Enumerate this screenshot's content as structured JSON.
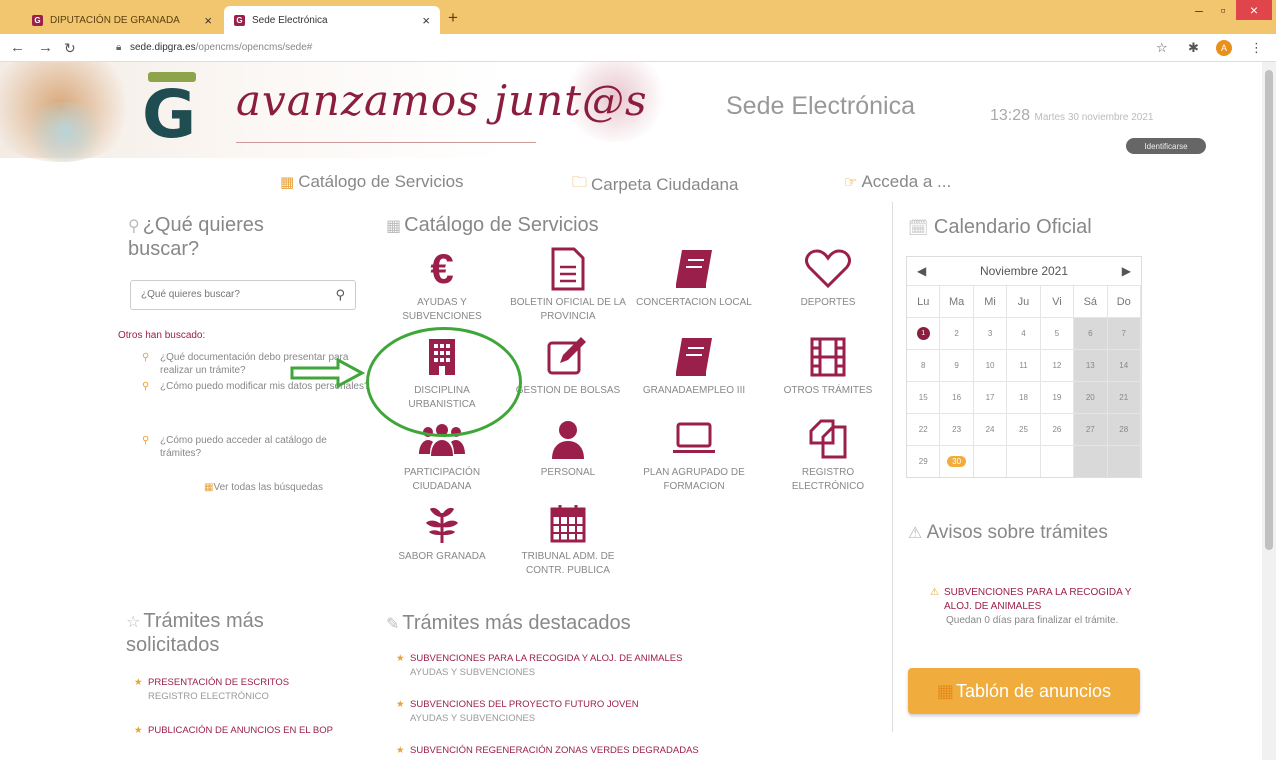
{
  "browser": {
    "tabs": [
      {
        "label": "DIPUTACIÓN DE GRANADA",
        "favicon": "G"
      },
      {
        "label": "Sede Electrónica",
        "favicon": "G"
      }
    ],
    "url_host": "sede.dipgra.es",
    "url_path": "/opencms/opencms/sede#",
    "profile_initial": "A"
  },
  "header": {
    "slogan": "avanzamos junt@s",
    "site_title": "Sede Electrónica",
    "time": "13:28",
    "date": "Martes 30 noviembre 2021",
    "login_label": "Identificarse"
  },
  "topnav": {
    "catalog": "Catálogo de Servicios",
    "folder": "Carpeta Ciudadana",
    "access": "Acceda a ..."
  },
  "search": {
    "title": "¿Qué quieres buscar?",
    "placeholder": "¿Qué quieres buscar?",
    "others_label": "Otros han buscado:",
    "items": [
      "¿Qué documentación debo presentar para realizar un trámite?",
      "¿Cómo puedo modificar mis datos personales?",
      "¿Cómo puedo acceder al catálogo de trámites?"
    ],
    "see_all": "Ver todas las búsquedas"
  },
  "catalog": {
    "title": "Catálogo de Servicios",
    "services": [
      {
        "label": "AYUDAS Y SUBVENCIONES",
        "icon": "euro-icon"
      },
      {
        "label": "BOLETIN OFICIAL DE LA PROVINCIA",
        "icon": "document-icon"
      },
      {
        "label": "CONCERTACION LOCAL",
        "icon": "book-icon"
      },
      {
        "label": "DEPORTES",
        "icon": "heart-icon"
      },
      {
        "label": "DISCIPLINA URBANISTICA",
        "icon": "building-icon"
      },
      {
        "label": "GESTION DE BOLSAS",
        "icon": "edit-icon"
      },
      {
        "label": "GRANADAEMPLEO III",
        "icon": "book-icon"
      },
      {
        "label": "OTROS TRÁMITES",
        "icon": "film-icon"
      },
      {
        "label": "PARTICIPACIÓN CIUDADANA",
        "icon": "group-icon"
      },
      {
        "label": "PERSONAL",
        "icon": "user-icon"
      },
      {
        "label": "PLAN AGRUPADO DE FORMACION",
        "icon": "laptop-icon"
      },
      {
        "label": "REGISTRO ELECTRÓNICO",
        "icon": "copy-icon"
      },
      {
        "label": "SABOR GRANADA",
        "icon": "leaf-icon"
      },
      {
        "label": "TRIBUNAL ADM. DE CONTR. PUBLICA",
        "icon": "calendar-icon"
      }
    ]
  },
  "calendar": {
    "title": "Calendario Oficial",
    "month": "Noviembre 2021",
    "weekdays": [
      "Lu",
      "Ma",
      "Mi",
      "Ju",
      "Vi",
      "Sá",
      "Do"
    ],
    "weeks": [
      [
        "1",
        "2",
        "3",
        "4",
        "5",
        "6",
        "7"
      ],
      [
        "8",
        "9",
        "10",
        "11",
        "12",
        "13",
        "14"
      ],
      [
        "15",
        "16",
        "17",
        "18",
        "19",
        "20",
        "21"
      ],
      [
        "22",
        "23",
        "24",
        "25",
        "26",
        "27",
        "28"
      ],
      [
        "29",
        "30",
        "",
        "",
        "",
        "",
        ""
      ]
    ]
  },
  "notices": {
    "title": "Avisos sobre trámites",
    "item_title": "SUBVENCIONES PARA LA RECOGIDA Y ALOJ. DE ANIMALES",
    "item_desc": "Quedan 0 días para finalizar el trámite."
  },
  "board_button": "Tablón de anuncios",
  "most_requested": {
    "title": "Trámites más solicitados",
    "items": [
      {
        "title": "PRESENTACIÓN DE ESCRITOS",
        "sub": "REGISTRO ELECTRÓNICO"
      },
      {
        "title": "PUBLICACIÓN DE ANUNCIOS EN EL BOP",
        "sub": ""
      }
    ]
  },
  "featured": {
    "title": "Trámites más destacados",
    "items": [
      {
        "title": "SUBVENCIONES PARA LA RECOGIDA Y ALOJ. DE ANIMALES",
        "sub": "AYUDAS Y SUBVENCIONES"
      },
      {
        "title": "SUBVENCIONES DEL PROYECTO FUTURO JOVEN",
        "sub": "AYUDAS Y SUBVENCIONES"
      },
      {
        "title": "SUBVENCIÓN REGENERACIÓN ZONAS VERDES DEGRADADAS",
        "sub": ""
      }
    ]
  },
  "colors": {
    "brand": "#9b1f4b",
    "accent": "#f0ac3c",
    "highlight": "#3fa63a"
  }
}
